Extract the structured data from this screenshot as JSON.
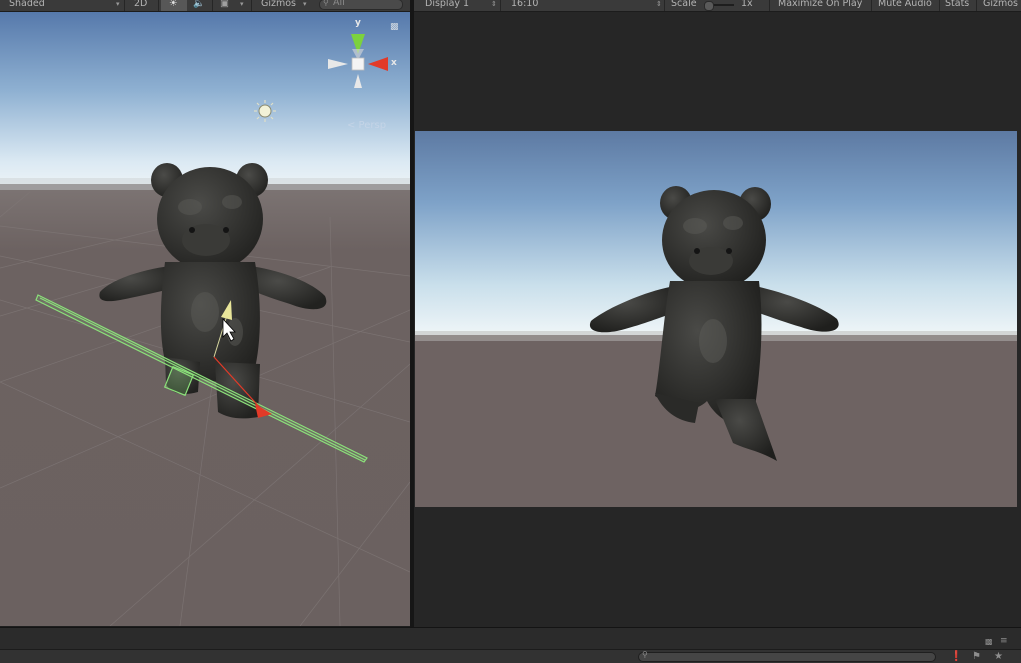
{
  "scene_toolbar": {
    "shading_mode": "Shaded",
    "mode_2d": "2D",
    "gizmos_label": "Gizmos",
    "search_placeholder": "All",
    "icons": [
      "sun-icon",
      "audio-icon",
      "image-effects-icon",
      "chevron-down-icon",
      "search-icon"
    ]
  },
  "game_toolbar": {
    "display": "Display 1",
    "aspect": "16:10",
    "scale_label": "Scale",
    "scale_value": 0.0,
    "scale_readout": "1x",
    "maximize_on_play": "Maximize On Play",
    "mute_audio": "Mute Audio",
    "stats": "Stats",
    "gizmos": "Gizmos"
  },
  "scene_view": {
    "projection_label": "< Persp",
    "axis_y": "y",
    "axis_x": "x",
    "icons": [
      "lock-icon",
      "directional-light-icon",
      "scene-gizmo-icon",
      "move-tool-icon",
      "mouse-cursor-icon"
    ]
  },
  "bottom_panel": {
    "icons": [
      "lock-icon",
      "menu-icon",
      "search-icon",
      "log-icon",
      "warning-icon",
      "star-icon"
    ]
  },
  "colors": {
    "toolbar_bg": "#3a3a3a",
    "sky_top": "#5b7fb0",
    "sky_horizon": "#e6f0f6",
    "ground": "#6e6362",
    "collider_green": "#8be07a",
    "x_axis_red": "#e23a28",
    "y_axis_green": "#7cd23d"
  }
}
